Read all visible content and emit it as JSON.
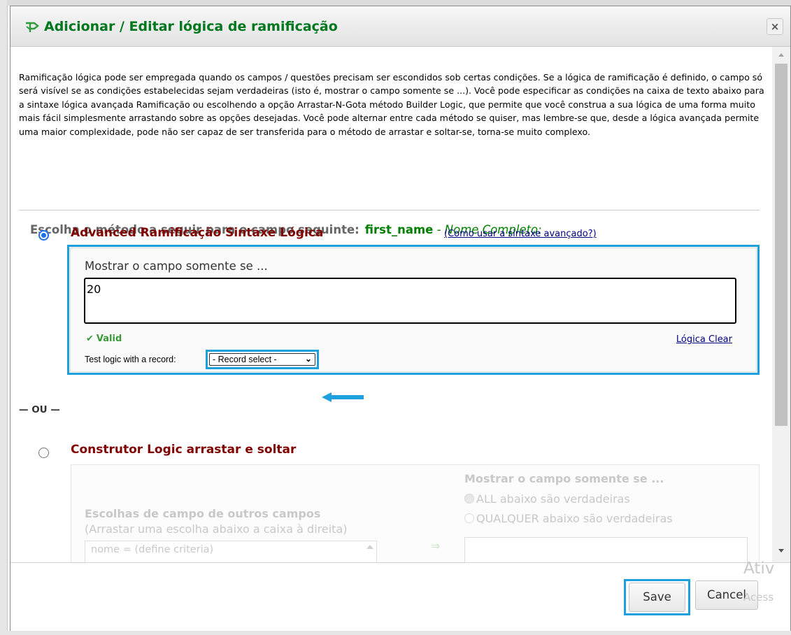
{
  "dialog": {
    "title": "Adicionar / Editar lógica de ramificação",
    "close_symbol": "×",
    "intro_text": "Ramificação lógica pode ser empregada quando os campos / questões precisam ser escondidos sob certas condições. Se a lógica de ramificação é definido, o campo só será visível se as condições estabelecidas sejam verdadeiras (isto é, mostrar o campo somente se ...). Você pode especificar as condições na caixa de texto abaixo para a sintaxe lógica avançada Ramificação ou escolhendo a opção Arrastar-N-Gota método Builder Logic, que permite que você construa a sua lógica de uma forma muito mais fácil simplesmente arrastando sobre as opções desejadas. Você pode alternar entre cada método se quiser, mas lembre-se que, desde a lógica avançada permite uma maior complexidade, pode não ser capaz de ser transferida para o método de arrastar e soltar-se, torna-se muito complexo.",
    "choose_label": "Escolha o método a seguir para o campo seguinte:",
    "field_name": "first_name",
    "field_label": " - Nome Completo:"
  },
  "advanced": {
    "title": "Advanced Ramificação Sintaxe Lógica",
    "howto_link": "(Como usar a sintaxe avançado?)",
    "show_label": "Mostrar o campo somente se ...",
    "logic_value": "20",
    "valid_check": "✔",
    "valid_text": "Valid",
    "clear_link": "Lógica Clear",
    "test_label": "Test logic with a record:",
    "record_select": "- Record select -",
    "selected": true
  },
  "or_separator": "— OU —",
  "dragdrop": {
    "title": "Construtor Logic arrastar e soltar",
    "choices_title": "Escolhas de campo de outros campos",
    "choices_sub": "(Arrastar uma escolha abaixo a caixa à direita)",
    "choice_item": "nome = (define criteria)",
    "arrow": "⇒",
    "show_label": "Mostrar o campo somente se ...",
    "opt_all": "ALL abaixo são verdadeiras",
    "opt_any": "QUALQUER abaixo são verdadeiras",
    "selected": false
  },
  "footer": {
    "save_label": "Save",
    "cancel_label": "Cancel"
  },
  "watermark": {
    "line1": "Ativ",
    "line2": "Acess"
  },
  "colors": {
    "title_green": "#00771d",
    "section_maroon": "#800000",
    "highlight_blue": "#1ea0dc",
    "valid_green": "#3a9a3a",
    "link_navy": "#000080"
  }
}
